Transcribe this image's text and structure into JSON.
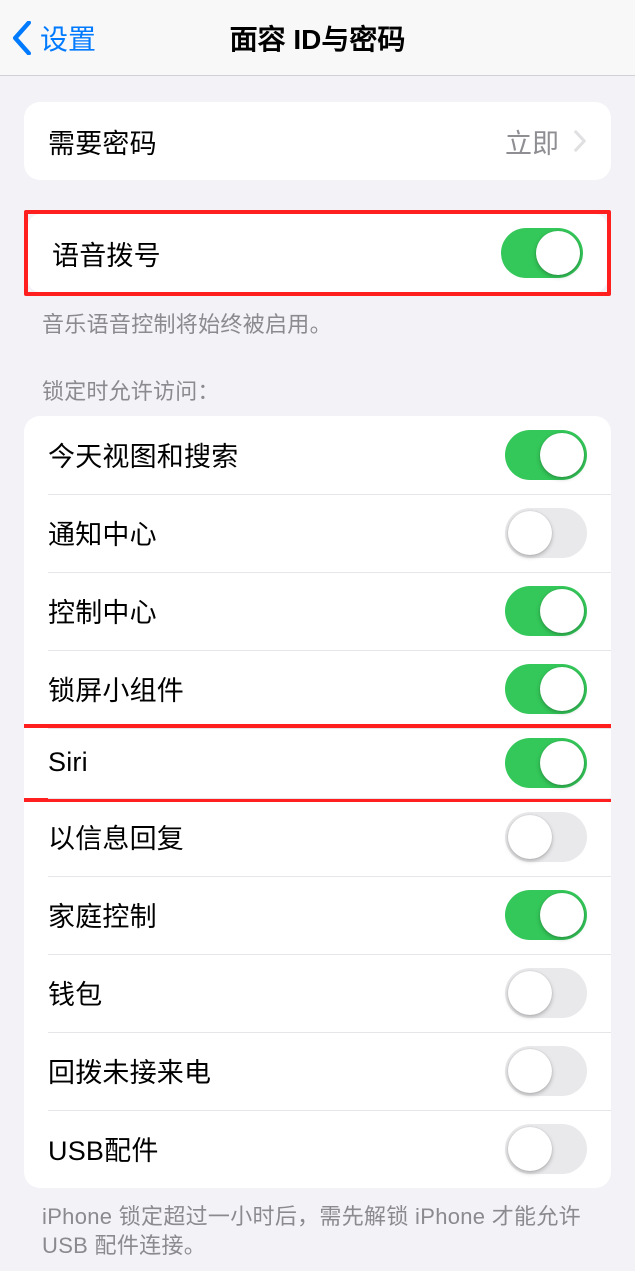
{
  "nav": {
    "back_label": "设置",
    "title": "面容 ID与密码"
  },
  "group_passcode": {
    "require_passcode_label": "需要密码",
    "require_passcode_value": "立即"
  },
  "group_voice": {
    "voice_dial_label": "语音拨号",
    "voice_dial_footer": "音乐语音控制将始终被启用。"
  },
  "lockscreen_access": {
    "header": "锁定时允许访问：",
    "items": [
      {
        "label": "今天视图和搜索",
        "on": true
      },
      {
        "label": "通知中心",
        "on": false
      },
      {
        "label": "控制中心",
        "on": true
      },
      {
        "label": "锁屏小组件",
        "on": true
      },
      {
        "label": "Siri",
        "on": true
      },
      {
        "label": "以信息回复",
        "on": false
      },
      {
        "label": "家庭控制",
        "on": true
      },
      {
        "label": "钱包",
        "on": false
      },
      {
        "label": "回拨未接来电",
        "on": false
      },
      {
        "label": "USB配件",
        "on": false
      }
    ],
    "footer": "iPhone 锁定超过一小时后，需先解锁 iPhone 才能允许USB 配件连接。"
  }
}
